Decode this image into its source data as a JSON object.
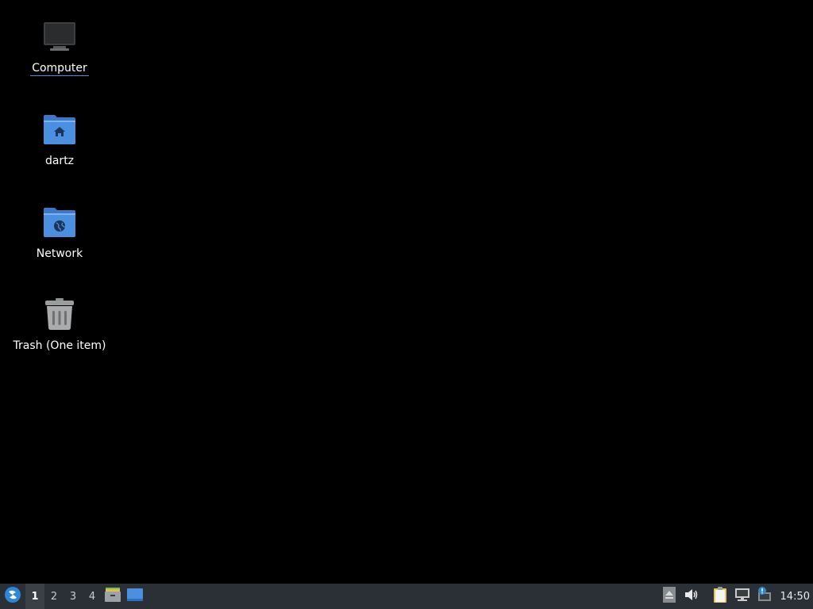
{
  "desktop": {
    "icons": [
      {
        "label": "Computer",
        "icon": "computer-icon",
        "selected": true
      },
      {
        "label": "dartz",
        "icon": "home-folder-icon"
      },
      {
        "label": "Network",
        "icon": "network-folder-icon"
      },
      {
        "label": "Trash (One item)",
        "icon": "trash-icon"
      }
    ]
  },
  "taskbar": {
    "start_icon": "lxqt-start-menu-icon",
    "workspaces": [
      "1",
      "2",
      "3",
      "4"
    ],
    "active_workspace": "1",
    "launchers": [
      "file-manager-icon",
      "show-desktop-icon"
    ],
    "tray": [
      "removable-media-icon",
      "volume-icon",
      "clipboard-icon",
      "network-connection-icon",
      "update-notifier-icon"
    ],
    "clock": "14:50"
  },
  "colors": {
    "desktop_bg": "#000000",
    "panel_bg": "#2b3036",
    "folder_blue": "#4a8fe0",
    "selection_underline": "#4a8fe0"
  }
}
